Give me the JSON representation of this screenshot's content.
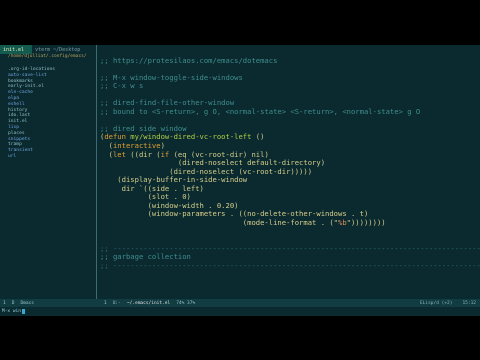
{
  "left_pane": {
    "tabs": [
      {
        "label": "init.el",
        "active": true
      },
      {
        "label": "vterm ~/Desktop",
        "active": false
      }
    ],
    "path": "/home/djulliat/.config/emacs/",
    "tree": [
      {
        "name": ".org-id-locations",
        "is_dir": false
      },
      {
        "name": "auto-save-list",
        "is_dir": true
      },
      {
        "name": "bookmarks",
        "is_dir": false
      },
      {
        "name": "early-init.el",
        "is_dir": false
      },
      {
        "name": "eln-cache",
        "is_dir": true
      },
      {
        "name": "elpa",
        "is_dir": true
      },
      {
        "name": "eshell",
        "is_dir": true
      },
      {
        "name": "history",
        "is_dir": false
      },
      {
        "name": "ido.last",
        "is_dir": false
      },
      {
        "name": "init.el",
        "is_dir": false
      },
      {
        "name": "lisp",
        "is_dir": true
      },
      {
        "name": "places",
        "is_dir": false
      },
      {
        "name": "snippets",
        "is_dir": true
      },
      {
        "name": "tramp",
        "is_dir": false
      },
      {
        "name": "transient",
        "is_dir": true
      },
      {
        "name": "url",
        "is_dir": true
      }
    ]
  },
  "code_lines": [
    {
      "t": "bl",
      "segs": []
    },
    {
      "t": "cm",
      "segs": [
        {
          "c": "cm",
          "v": ";; https://protesilaos.com/emacs/dotemacs"
        }
      ]
    },
    {
      "t": "bl",
      "segs": []
    },
    {
      "t": "cm",
      "segs": [
        {
          "c": "cm",
          "v": ";; M-x window-toggle-side-windows"
        }
      ]
    },
    {
      "t": "cm",
      "segs": [
        {
          "c": "cm",
          "v": ";; C-x w s"
        }
      ]
    },
    {
      "t": "bl",
      "segs": []
    },
    {
      "t": "cm",
      "segs": [
        {
          "c": "cm",
          "v": ";; dired-find-file-other-window"
        }
      ]
    },
    {
      "t": "cm",
      "segs": [
        {
          "c": "cm",
          "v": ";; bound to <S-return>, g O, <normal-state> <S-return>, <normal-state> g O"
        }
      ]
    },
    {
      "t": "bl",
      "segs": []
    },
    {
      "t": "cm",
      "segs": [
        {
          "c": "cm",
          "v": ";; dired side window"
        }
      ]
    },
    {
      "t": "code",
      "segs": [
        {
          "c": "tx",
          "v": "("
        },
        {
          "c": "kw",
          "v": "defun"
        },
        {
          "c": "tx",
          "v": " "
        },
        {
          "c": "fn",
          "v": "my/window-dired-vc-root-left"
        },
        {
          "c": "tx",
          "v": " ()"
        }
      ]
    },
    {
      "t": "code",
      "segs": [
        {
          "c": "tx",
          "v": "  ("
        },
        {
          "c": "kw",
          "v": "interactive"
        },
        {
          "c": "tx",
          "v": ")"
        }
      ]
    },
    {
      "t": "code",
      "segs": [
        {
          "c": "tx",
          "v": "  ("
        },
        {
          "c": "kw",
          "v": "let"
        },
        {
          "c": "tx",
          "v": " ((dir ("
        },
        {
          "c": "kw",
          "v": "if"
        },
        {
          "c": "tx",
          "v": " (eq (vc-root-dir) nil)"
        }
      ]
    },
    {
      "t": "code",
      "segs": [
        {
          "c": "tx",
          "v": "                  (dired-noselect default-directory)"
        }
      ]
    },
    {
      "t": "code",
      "segs": [
        {
          "c": "tx",
          "v": "                (dired-noselect (vc-root-dir)))))"
        }
      ]
    },
    {
      "t": "code",
      "segs": [
        {
          "c": "tx",
          "v": "    (display-buffer-in-side-window"
        }
      ]
    },
    {
      "t": "code",
      "segs": [
        {
          "c": "tx",
          "v": "     dir `((side . left)"
        }
      ]
    },
    {
      "t": "code",
      "segs": [
        {
          "c": "tx",
          "v": "           (slot . 0)"
        }
      ]
    },
    {
      "t": "code",
      "segs": [
        {
          "c": "tx",
          "v": "           (window-width . 0.20)"
        }
      ]
    },
    {
      "t": "code",
      "segs": [
        {
          "c": "tx",
          "v": "           (window-parameters . ((no-delete-other-windows . t)"
        }
      ]
    },
    {
      "t": "code",
      "segs": [
        {
          "c": "tx",
          "v": "                                 (mode-line-format . (\""
        },
        {
          "c": "st",
          "v": "%b"
        },
        {
          "c": "tx",
          "v": "\"))))))))"
        }
      ]
    },
    {
      "t": "bl",
      "segs": []
    },
    {
      "t": "bl",
      "segs": []
    },
    {
      "t": "sep",
      "segs": [
        {
          "c": "sep",
          "v": ";; ------------------------------------------------------------------------------------------"
        }
      ]
    },
    {
      "t": "cm",
      "segs": [
        {
          "c": "cm",
          "v": ";; garbage collection"
        }
      ]
    },
    {
      "t": "sep",
      "segs": [
        {
          "c": "sep",
          "v": ";; ------------------------------------------------------------------------------------------"
        }
      ]
    },
    {
      "t": "bl",
      "segs": []
    },
    {
      "t": "code",
      "segs": [
        {
          "c": "tx",
          "v": "  "
        }
      ]
    }
  ],
  "modeline": {
    "left_state": "1",
    "left_indicator": "D",
    "left_mode": "Dmacs",
    "right_state": "1",
    "right_flag": "U:-",
    "right_file": "~/.emacs/init.el",
    "right_pos": "74% 37%",
    "right_mode": "ELisp/d (+2)",
    "right_time": "15:12"
  },
  "minibuffer": {
    "text": "M-x win"
  }
}
